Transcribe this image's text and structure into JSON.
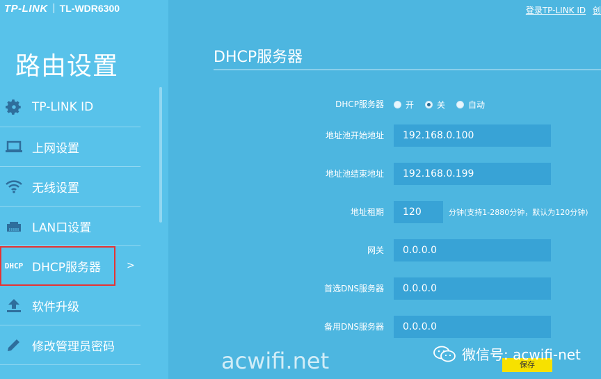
{
  "brand": {
    "logo": "TP-LINK",
    "model": "TL-WDR6300"
  },
  "header": {
    "login_link": "登录TP-LINK ID",
    "extra_link": "创"
  },
  "sidebar": {
    "title": "路由设置",
    "items": [
      {
        "label": "TP-LINK ID",
        "icon": "gear-icon"
      },
      {
        "label": "上网设置",
        "icon": "laptop-icon"
      },
      {
        "label": "无线设置",
        "icon": "wifi-icon"
      },
      {
        "label": "LAN口设置",
        "icon": "lan-port-icon"
      },
      {
        "label": "DHCP服务器",
        "icon": "dhcp-icon",
        "active": true,
        "icon_text_top": "DH",
        "icon_text_bottom": "CP"
      },
      {
        "label": "软件升级",
        "icon": "upgrade-arrow-icon"
      },
      {
        "label": "修改管理员密码",
        "icon": "pencil-icon"
      }
    ],
    "active_arrow": ">"
  },
  "main": {
    "title": "DHCP服务器",
    "dhcp_server": {
      "label": "DHCP服务器",
      "options": [
        "开",
        "关",
        "自动"
      ],
      "selected": "关"
    },
    "pool_start": {
      "label": "地址池开始地址",
      "value": "192.168.0.100"
    },
    "pool_end": {
      "label": "地址池结束地址",
      "value": "192.168.0.199"
    },
    "lease": {
      "label": "地址租期",
      "value": "120",
      "hint": "分钟(支持1-2880分钟，默认为120分钟)"
    },
    "gateway": {
      "label": "网关",
      "value": "0.0.0.0"
    },
    "dns_primary": {
      "label": "首选DNS服务器",
      "value": "0.0.0.0"
    },
    "dns_secondary": {
      "label": "备用DNS服务器",
      "value": "0.0.0.0"
    },
    "save_label": "保存"
  },
  "watermark": {
    "left": "acwifi.net",
    "right": "微信号: acwifi-net"
  },
  "colors": {
    "sidebar_bg": "#58c2ea",
    "main_bg": "#4db6e0",
    "field_bg": "#38a3d6",
    "save_bg": "#f7e100",
    "active_outline": "#e63333"
  }
}
